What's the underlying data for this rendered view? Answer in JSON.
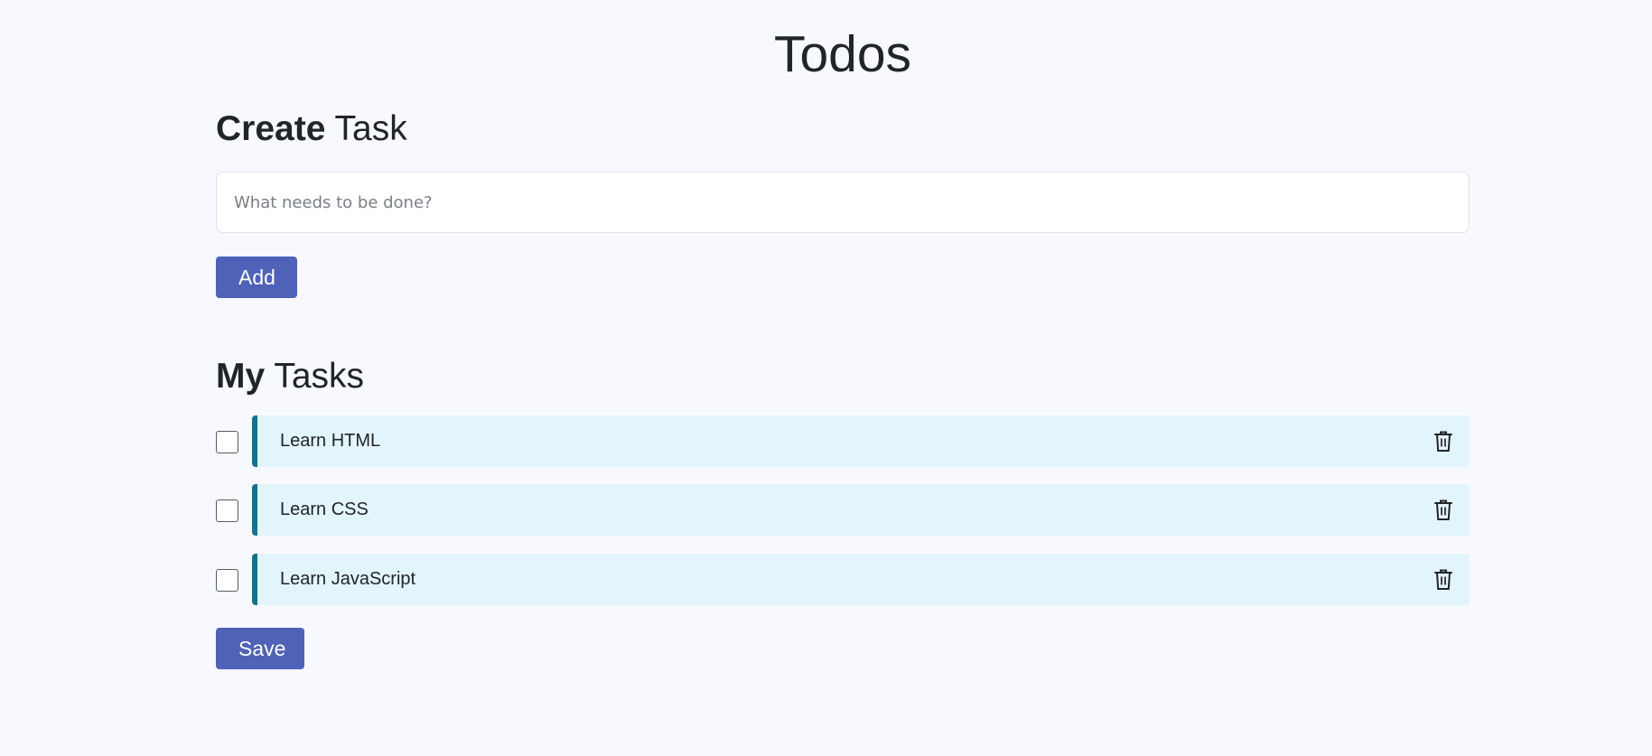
{
  "app_title": "Todos",
  "create_section": {
    "heading_bold": "Create",
    "heading_rest": " Task",
    "input_placeholder": "What needs to be done?",
    "input_value": "",
    "add_label": "Add"
  },
  "tasks_section": {
    "heading_bold": "My",
    "heading_rest": " Tasks",
    "tasks": [
      {
        "label": "Learn HTML",
        "checked": false,
        "icon": "trash-icon"
      },
      {
        "label": "Learn CSS",
        "checked": false,
        "icon": "trash-icon"
      },
      {
        "label": "Learn JavaScript",
        "checked": false,
        "icon": "trash-icon"
      }
    ],
    "save_label": "Save"
  },
  "colors": {
    "background": "#f8f9fe",
    "primary_button": "#4f62b7",
    "task_card": "#e3f5fc",
    "task_accent": "#17718e"
  }
}
